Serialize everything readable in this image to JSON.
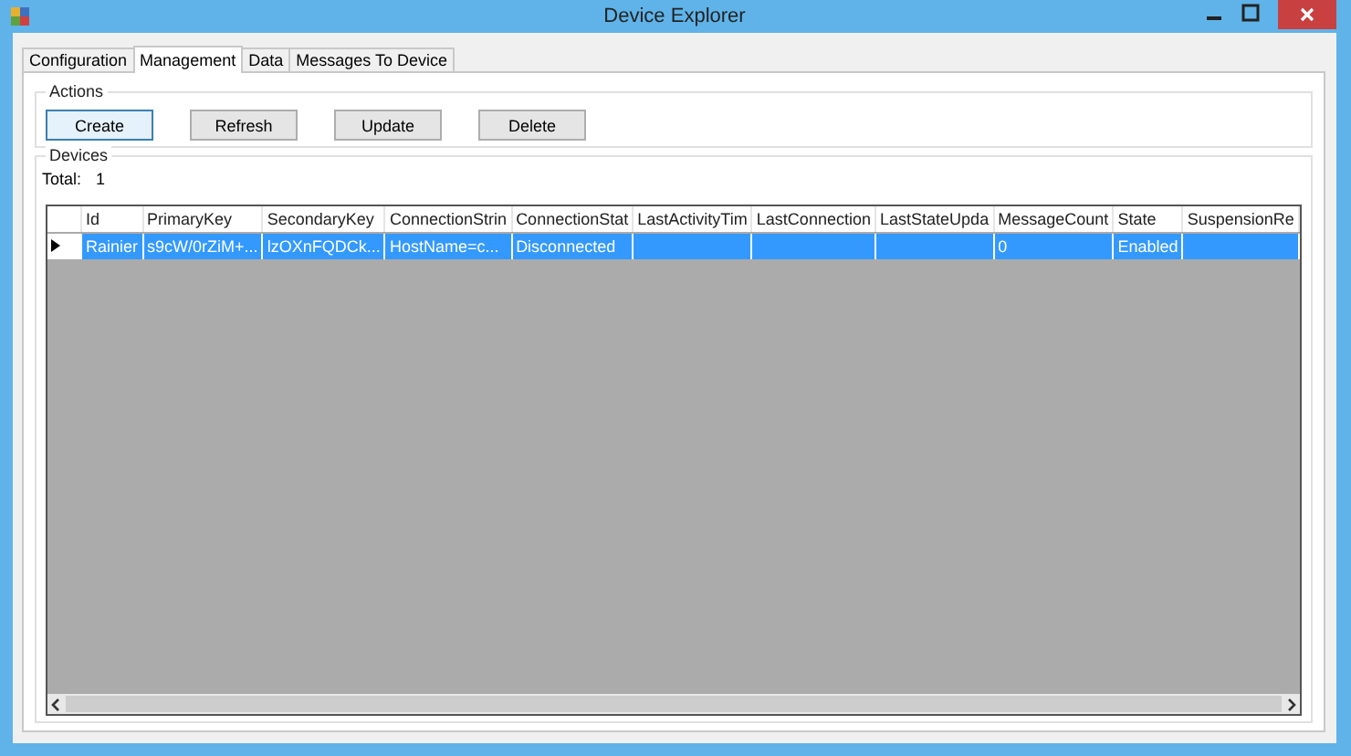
{
  "window": {
    "title": "Device Explorer"
  },
  "tabs": [
    {
      "label": "Configuration",
      "selected": false
    },
    {
      "label": "Management",
      "selected": true
    },
    {
      "label": "Data",
      "selected": false
    },
    {
      "label": "Messages To Device",
      "selected": false
    }
  ],
  "actions": {
    "title": "Actions",
    "buttons": [
      {
        "label": "Create",
        "focused": true
      },
      {
        "label": "Refresh",
        "focused": false
      },
      {
        "label": "Update",
        "focused": false
      },
      {
        "label": "Delete",
        "focused": false
      }
    ]
  },
  "devices": {
    "title": "Devices",
    "total_label": "Total:",
    "total": "1",
    "table": {
      "columns": [
        "Id",
        "PrimaryKey",
        "SecondaryKey",
        "ConnectionStrin",
        "ConnectionStat",
        "LastActivityTim",
        "LastConnection",
        "LastStateUpda",
        "MessageCount",
        "State",
        "SuspensionRe"
      ],
      "rows": [
        {
          "selected": true,
          "cells": [
            "Rainier",
            "s9cW/0rZiM+...",
            "lzOXnFQDCk...",
            "HostName=c...",
            "Disconnected",
            "",
            "",
            "",
            "0",
            "Enabled",
            ""
          ]
        }
      ]
    }
  }
}
